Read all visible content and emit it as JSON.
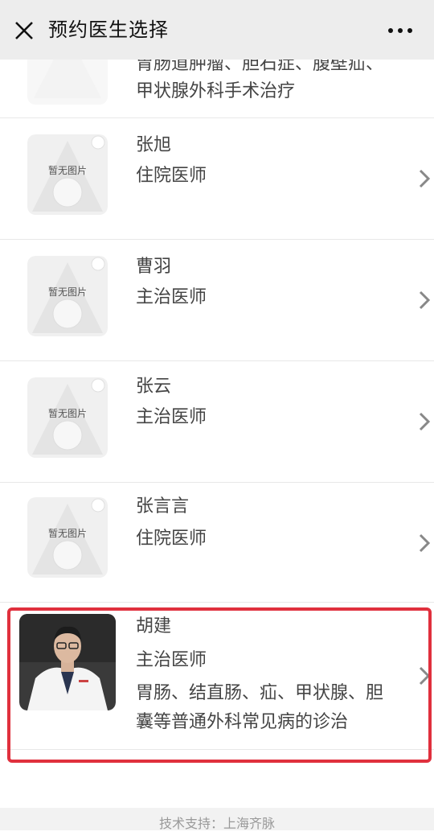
{
  "nav": {
    "title": "预约医生选择",
    "close_icon": "close-icon",
    "more_icon": "more-dots-icon"
  },
  "top_partial": {
    "desc_line1": "胃肠道肿瘤、胆石症、腹壁疝、",
    "desc_line2": "甲状腺外科手术治疗"
  },
  "placeholder_text": "暂无图片",
  "doctors": [
    {
      "name": "张旭",
      "title": "住院医师"
    },
    {
      "name": "曹羽",
      "title": "主治医师"
    },
    {
      "name": "张云",
      "title": "主治医师"
    },
    {
      "name": "张言言",
      "title": "住院医师"
    },
    {
      "name": "胡建",
      "title": "主治医师",
      "desc_line1": "胃肠、结直肠、疝、甲状腺、胆",
      "desc_line2": "囊等普通外科常见病的诊治"
    }
  ],
  "footer": {
    "text": "技术支持：上海齐脉"
  },
  "colors": {
    "highlight": "#e0303d",
    "navbar": "#ededed"
  }
}
